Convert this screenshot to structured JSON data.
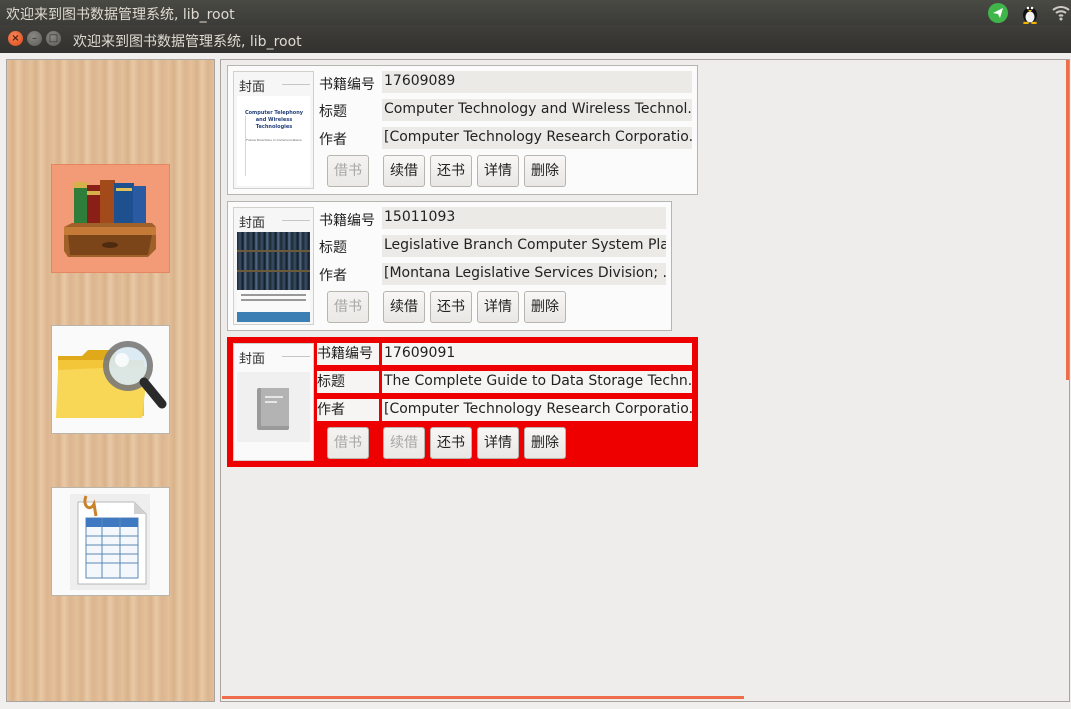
{
  "system_bar": {
    "title": "欢迎来到图书数据管理系统, lib_root"
  },
  "window": {
    "title": "欢迎来到图书数据管理系统, lib_root",
    "close_glyph": "×",
    "min_glyph": "–",
    "max_glyph": "□"
  },
  "sidebar": {
    "items": [
      {
        "name": "books",
        "icon": "bookshelf-icon",
        "active": true
      },
      {
        "name": "search",
        "icon": "folder-search-icon",
        "active": false
      },
      {
        "name": "records",
        "icon": "spreadsheet-icon",
        "active": false
      }
    ]
  },
  "labels": {
    "cover": "封面",
    "book_id": "书籍编号",
    "title": "标题",
    "author": "作者",
    "borrow": "借书",
    "renew": "续借",
    "return": "还书",
    "detail": "详情",
    "delete": "删除"
  },
  "books": [
    {
      "id": "17609089",
      "title": "Computer Technology and Wireless Technol...",
      "author": "[Computer Technology Research Corporatio...",
      "cover_title": "Computer Telephony and Wireless Technologies",
      "cover_subtitle": "Future Directions in Communications",
      "borrow_enabled": false,
      "renew_enabled": true,
      "selected": false
    },
    {
      "id": "15011093",
      "title": "Legislative Branch Computer System Plan",
      "author": "[Montana Legislative Services Division; ...",
      "borrow_enabled": false,
      "renew_enabled": true,
      "selected": false
    },
    {
      "id": "17609091",
      "title": "The Complete Guide to Data Storage Techn...",
      "author": "[Computer Technology Research Corporatio...",
      "borrow_enabled": false,
      "renew_enabled": false,
      "selected": true
    }
  ],
  "colors": {
    "accent": "#ef0000",
    "active_nav": "#f39b77",
    "scrollbar": "#ee6e4a",
    "tray_send": "#3fb54a"
  }
}
